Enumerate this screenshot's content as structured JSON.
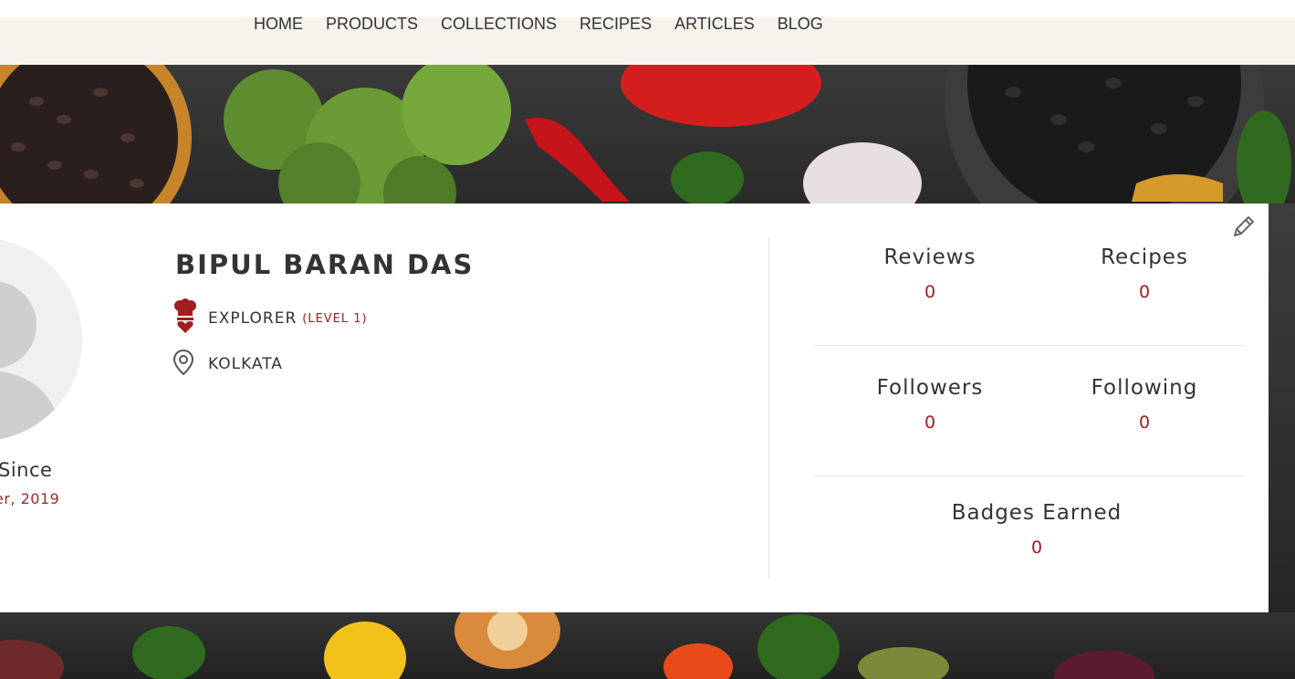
{
  "nav": {
    "items": [
      "HOME",
      "PRODUCTS",
      "COLLECTIONS",
      "RECIPES",
      "ARTICLES",
      "BLOG"
    ]
  },
  "profile": {
    "name": "BIPUL BARAN DAS",
    "rank": "EXPLORER",
    "level": "(LEVEL 1)",
    "location": "KOLKATA",
    "member_since_label": "Since",
    "member_since_value": "er, 2019"
  },
  "stats": {
    "reviews_label": "Reviews",
    "reviews_value": "0",
    "recipes_label": "Recipes",
    "recipes_value": "0",
    "followers_label": "Followers",
    "followers_value": "0",
    "following_label": "Following",
    "following_value": "0",
    "badges_label": "Badges Earned",
    "badges_value": "0"
  },
  "colors": {
    "accent": "#a01e1e",
    "navbar_bg": "#f5f3ec"
  },
  "icons": {
    "edit": "pencil-icon",
    "rank": "chef-hat-icon",
    "location": "map-pin-icon"
  }
}
